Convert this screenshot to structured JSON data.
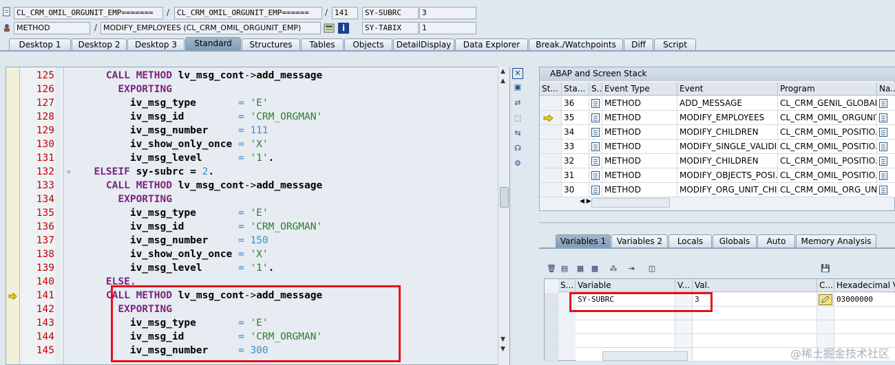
{
  "header": {
    "row1": {
      "class_field": "CL_CRM_OMIL_ORGUNIT_EMP=======",
      "slash1": "/",
      "include_field": "CL_CRM_OMIL_ORGUNIT_EMP======",
      "slash2": "/",
      "line_field": "141",
      "sysvar_label": "SY-SUBRC",
      "sysvar_value": "3"
    },
    "row2": {
      "type_field": "METHOD",
      "slash": "/",
      "method_field": "MODIFY_EMPLOYEES (CL_CRM_OMIL_ORGUNIT_EMP)",
      "sysvar_label": "SY-TABIX",
      "sysvar_value": "1"
    }
  },
  "tabs": [
    "Desktop 1",
    "Desktop 2",
    "Desktop 3",
    "Standard",
    "Structures",
    "Tables",
    "Objects",
    "DetailDisplay",
    "Data Explorer",
    "Break./Watchpoints",
    "Diff",
    "Script"
  ],
  "active_tab": "Standard",
  "code": {
    "lines": [
      {
        "num": "125",
        "kw1": "CALL METHOD",
        "rest": " lv_msg_cont->add_message",
        "indent": "    "
      },
      {
        "num": "126",
        "kw1": "EXPORTING",
        "rest": "",
        "indent": "      "
      },
      {
        "num": "127",
        "name": "iv_msg_type",
        "pad": "       = ",
        "val": "'E'",
        "valtype": "str",
        "indent": "        "
      },
      {
        "num": "128",
        "name": "iv_msg_id",
        "pad": "         = ",
        "val": "'CRM_ORGMAN'",
        "valtype": "str",
        "indent": "        "
      },
      {
        "num": "129",
        "name": "iv_msg_number",
        "pad": "     = ",
        "val": "111",
        "valtype": "num",
        "indent": "        "
      },
      {
        "num": "130",
        "name": "iv_show_only_once",
        "pad": " = ",
        "val": "'X'",
        "valtype": "str",
        "indent": "        "
      },
      {
        "num": "131",
        "name": "iv_msg_level",
        "pad": "      = ",
        "val": "'1'.",
        "valtype": "str",
        "indent": "        "
      },
      {
        "num": "132",
        "kw1": "ELSEIF",
        "rest": " sy-subrc = ",
        "val": "2",
        "tail": ".",
        "indent": "  "
      },
      {
        "num": "133",
        "kw1": "CALL METHOD",
        "rest": " lv_msg_cont->add_message",
        "indent": "    "
      },
      {
        "num": "134",
        "kw1": "EXPORTING",
        "rest": "",
        "indent": "      "
      },
      {
        "num": "135",
        "name": "iv_msg_type",
        "pad": "       = ",
        "val": "'E'",
        "valtype": "str",
        "indent": "        "
      },
      {
        "num": "136",
        "name": "iv_msg_id",
        "pad": "         = ",
        "val": "'CRM_ORGMAN'",
        "valtype": "str",
        "indent": "        "
      },
      {
        "num": "137",
        "name": "iv_msg_number",
        "pad": "     = ",
        "val": "150",
        "valtype": "num",
        "indent": "        "
      },
      {
        "num": "138",
        "name": "iv_show_only_once",
        "pad": " = ",
        "val": "'X'",
        "valtype": "str",
        "indent": "        "
      },
      {
        "num": "139",
        "name": "iv_msg_level",
        "pad": "      = ",
        "val": "'1'.",
        "valtype": "str",
        "indent": "        "
      },
      {
        "num": "140",
        "kw1": "ELSE.",
        "rest": "",
        "indent": "    "
      },
      {
        "num": "141",
        "kw1": "CALL METHOD",
        "rest": " lv_msg_cont->add_message",
        "indent": "    "
      },
      {
        "num": "142",
        "kw1": "EXPORTING",
        "rest": "",
        "indent": "      "
      },
      {
        "num": "143",
        "name": "iv_msg_type",
        "pad": "       = ",
        "val": "'E'",
        "valtype": "str",
        "indent": "        "
      },
      {
        "num": "144",
        "name": "iv_msg_id",
        "pad": "         = ",
        "val": "'CRM_ORGMAN'",
        "valtype": "str",
        "indent": "        "
      },
      {
        "num": "145",
        "name": "iv_msg_number",
        "pad": "     = ",
        "val": "300",
        "valtype": "num",
        "indent": "        "
      }
    ],
    "current_line": "141"
  },
  "stack": {
    "title": "ABAP and Screen Stack",
    "columns": [
      "St...",
      "Sta...",
      "S...",
      "Event Type",
      "Event",
      "Program",
      "Na..."
    ],
    "rows": [
      {
        "level": "36",
        "type": "METHOD",
        "event": "ADD_MESSAGE",
        "program": "CL_CRM_GENIL_GLOBAL_...",
        "current": false
      },
      {
        "level": "35",
        "type": "METHOD",
        "event": "MODIFY_EMPLOYEES",
        "program": "CL_CRM_OMIL_ORGUNIT_...",
        "current": true
      },
      {
        "level": "34",
        "type": "METHOD",
        "event": "MODIFY_CHILDREN",
        "program": "CL_CRM_OMIL_POSITIO...",
        "current": false
      },
      {
        "level": "33",
        "type": "METHOD",
        "event": "MODIFY_SINGLE_VALIDI...",
        "program": "CL_CRM_OMIL_POSITIO...",
        "current": false
      },
      {
        "level": "32",
        "type": "METHOD",
        "event": "MODIFY_CHILDREN",
        "program": "CL_CRM_OMIL_POSITIO...",
        "current": false
      },
      {
        "level": "31",
        "type": "METHOD",
        "event": "MODIFY_OBJECTS_POSI...",
        "program": "CL_CRM_OMIL_POSITIO...",
        "current": false
      },
      {
        "level": "30",
        "type": "METHOD",
        "event": "MODIFY_ORG_UNIT_CHI...",
        "program": "CL_CRM_OMIL_ORG_UNI...",
        "current": false
      }
    ]
  },
  "variables": {
    "tabs": [
      "Variables 1",
      "Variables 2",
      "Locals",
      "Globals",
      "Auto",
      "Memory Analysis"
    ],
    "active_tab": "Variables 1",
    "columns": [
      "S...",
      "Variable",
      "V...",
      "Val.",
      "C...",
      "Hexadecimal Va"
    ],
    "rows": [
      {
        "variable": "SY-SUBRC",
        "value": "3",
        "hex": "03000000"
      }
    ]
  },
  "watermark": "@稀土掘金技术社区",
  "colors": {
    "highlight": "#e8101a",
    "keyword": "#7f1f7f",
    "string": "#2f7a2f",
    "number": "#3a90d0",
    "line_number": "#c00000"
  }
}
